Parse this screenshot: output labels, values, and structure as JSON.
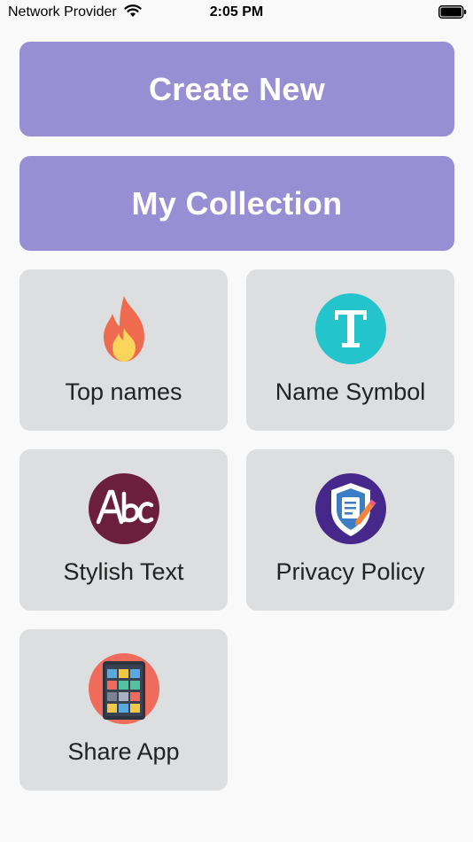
{
  "status_bar": {
    "carrier": "Network Provider",
    "time": "2:05 PM",
    "wifi_icon": "wifi-icon",
    "battery_icon": "battery-icon"
  },
  "actions": {
    "create_new": "Create New",
    "my_collection": "My Collection"
  },
  "tiles": [
    {
      "label": "Top names",
      "icon": "fire-icon"
    },
    {
      "label": "Name Symbol",
      "icon": "letter-t-icon"
    },
    {
      "label": "Stylish Text",
      "icon": "abc-icon"
    },
    {
      "label": "Privacy Policy",
      "icon": "shield-icon"
    },
    {
      "label": "Share App",
      "icon": "tablet-apps-icon"
    }
  ],
  "colors": {
    "primary_button": "#978ed4",
    "tile_background": "#dcdee0",
    "background": "#f9f9f9"
  }
}
